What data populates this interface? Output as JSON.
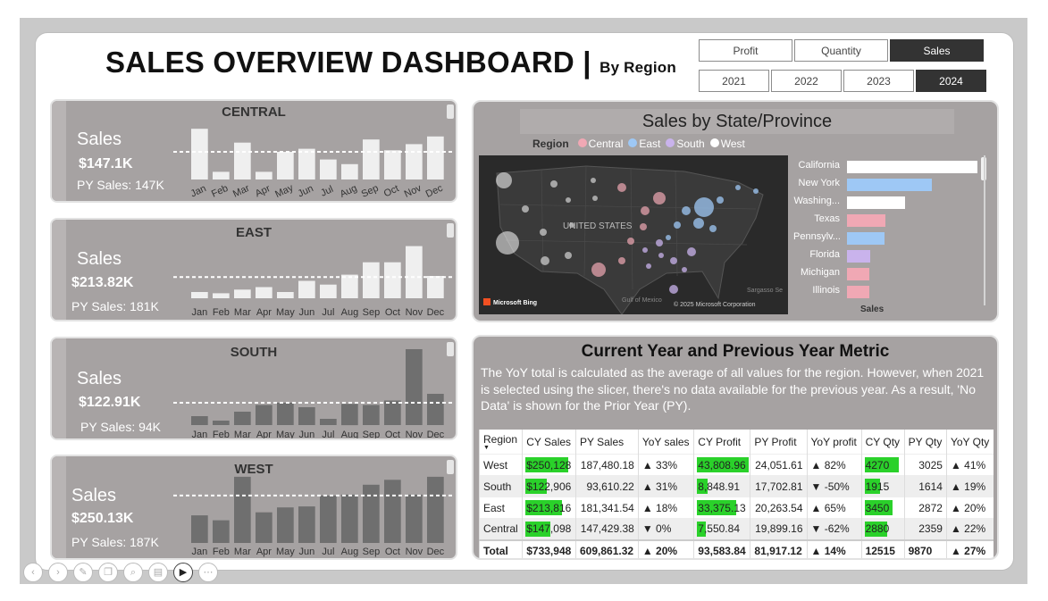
{
  "header": {
    "title": "SALES OVERVIEW DASHBOARD",
    "separator": "|",
    "subtitle": "By Region"
  },
  "measure_slicer": {
    "options": [
      "Profit",
      "Quantity",
      "Sales"
    ],
    "selected": "Sales"
  },
  "year_slicer": {
    "options": [
      "2021",
      "2022",
      "2023",
      "2024"
    ],
    "selected": "2024"
  },
  "region_cards": [
    {
      "region": "CENTRAL",
      "label": "Sales",
      "value": "$147.1K",
      "py": "PY Sales: 147K"
    },
    {
      "region": "EAST",
      "label": "Sales",
      "value": "$213.82K",
      "py": "PY Sales: 181K"
    },
    {
      "region": "SOUTH",
      "label": "Sales",
      "value": "$122.91K",
      "py": "PY Sales: 94K"
    },
    {
      "region": "WEST",
      "label": "Sales",
      "value": "$250.13K",
      "py": "PY Sales: 187K"
    }
  ],
  "chart_data": [
    {
      "type": "bar",
      "title": "CENTRAL",
      "categories": [
        "Jan",
        "Feb",
        "Mar",
        "Apr",
        "May",
        "Jun",
        "Jul",
        "Aug",
        "Sep",
        "Oct",
        "Nov",
        "Dec"
      ],
      "values": [
        16.5,
        2.5,
        12,
        2.5,
        9,
        10,
        6.5,
        5,
        13,
        9.5,
        11.5,
        14
      ],
      "ylim": [
        0,
        18
      ],
      "reference_line": 9
    },
    {
      "type": "bar",
      "title": "EAST",
      "categories": [
        "Jan",
        "Feb",
        "Mar",
        "Apr",
        "May",
        "Jun",
        "Jul",
        "Aug",
        "Sep",
        "Oct",
        "Nov",
        "Dec"
      ],
      "values": [
        2.5,
        2,
        3.5,
        4.5,
        2.5,
        7,
        5.5,
        9.5,
        14.5,
        14.5,
        21,
        9
      ],
      "ylim": [
        0,
        23
      ],
      "reference_line": 8.5
    },
    {
      "type": "bar",
      "title": "SOUTH",
      "categories": [
        "Jan",
        "Feb",
        "Mar",
        "Apr",
        "May",
        "Jun",
        "Jul",
        "Aug",
        "Sep",
        "Oct",
        "Nov",
        "Dec"
      ],
      "values": [
        4,
        2,
        6,
        9,
        10,
        8,
        2.8,
        9.5,
        9,
        11,
        34,
        14
      ],
      "ylim": [
        0,
        36
      ],
      "reference_line": 10
    },
    {
      "type": "bar",
      "title": "WEST",
      "categories": [
        "Jan",
        "Feb",
        "Mar",
        "Apr",
        "May",
        "Jun",
        "Jul",
        "Aug",
        "Sep",
        "Oct",
        "Nov",
        "Dec"
      ],
      "values": [
        14,
        11.5,
        33.5,
        15.5,
        18,
        18.5,
        24,
        24.5,
        29.5,
        32,
        24.5,
        33.5,
        34.5
      ],
      "ylim": [
        0,
        38
      ],
      "reference_line": 24
    }
  ],
  "map_panel": {
    "title": "Sales by State/Province",
    "legend_title": "Region",
    "legend": [
      {
        "name": "Central",
        "color": "#f0a8b4"
      },
      {
        "name": "East",
        "color": "#9ec8f5"
      },
      {
        "name": "South",
        "color": "#c9b3ec"
      },
      {
        "name": "West",
        "color": "#ffffff"
      }
    ],
    "map_label": "UNITED STATES",
    "map_labels_small": [
      "Gulf of Mexico",
      "Sargasso Se"
    ],
    "bing": "Microsoft Bing",
    "copyright": "© 2025 Microsoft Corporation",
    "bar_chart": {
      "type": "bar",
      "axis_title": "Sales",
      "states": [
        "California",
        "New York",
        "Washing...",
        "Texas",
        "Pennsylv...",
        "Florida",
        "Michigan",
        "Illinois"
      ],
      "values": [
        146,
        95,
        65,
        43,
        42,
        26,
        25,
        25
      ],
      "colors": [
        "#ffffff",
        "#9ec8f5",
        "#ffffff",
        "#f0a8b4",
        "#9ec8f5",
        "#c9b3ec",
        "#f0a8b4",
        "#f0a8b4"
      ]
    }
  },
  "metrics": {
    "title": "Current Year and Previous Year Metric",
    "description": "The YoY total is calculated as the average of all values for the region. However, when 2021 is selected using the slicer, there's no data available for the previous year. As a result, 'No Data' is shown for the Prior Year (PY).",
    "columns": [
      "Region",
      "CY Sales",
      "PY Sales",
      "YoY sales",
      "CY Profit",
      "PY Profit",
      "YoY profit",
      "CY Qty",
      "PY Qty",
      "YoY Qty"
    ],
    "rows": [
      {
        "region": "West",
        "cy_sales": "$250,128",
        "cy_sales_fill": 1.0,
        "py_sales": "187,480.18",
        "yoy_sales": "▲ 33%",
        "cy_profit": "43,808.96",
        "cy_profit_fill": 1.0,
        "py_profit": "24,051.61",
        "yoy_profit": "▲ 82%",
        "cy_qty": "4270",
        "cy_qty_fill": 1.0,
        "py_qty": "3025",
        "yoy_qty": "▲ 41%"
      },
      {
        "region": "South",
        "cy_sales": "$122,906",
        "cy_sales_fill": 0.49,
        "py_sales": "93,610.22",
        "yoy_sales": "▲ 31%",
        "cy_profit": "8,848.91",
        "cy_profit_fill": 0.2,
        "py_profit": "17,702.81",
        "yoy_profit": "▼ -50%",
        "cy_qty": "1915",
        "cy_qty_fill": 0.45,
        "py_qty": "1614",
        "yoy_qty": "▲ 19%"
      },
      {
        "region": "East",
        "cy_sales": "$213,816",
        "cy_sales_fill": 0.85,
        "py_sales": "181,341.54",
        "yoy_sales": "▲ 18%",
        "cy_profit": "33,375.13",
        "cy_profit_fill": 0.76,
        "py_profit": "20,263.54",
        "yoy_profit": "▲ 65%",
        "cy_qty": "3450",
        "cy_qty_fill": 0.81,
        "py_qty": "2872",
        "yoy_qty": "▲ 20%"
      },
      {
        "region": "Central",
        "cy_sales": "$147,098",
        "cy_sales_fill": 0.59,
        "py_sales": "147,429.38",
        "yoy_sales": "▼ 0%",
        "cy_profit": "7,550.84",
        "cy_profit_fill": 0.17,
        "py_profit": "19,899.16",
        "yoy_profit": "▼ -62%",
        "cy_qty": "2880",
        "cy_qty_fill": 0.67,
        "py_qty": "2359",
        "yoy_qty": "▲ 22%"
      }
    ],
    "total": {
      "region": "Total",
      "cy_sales": "$733,948",
      "py_sales": "609,861.32",
      "yoy_sales": "▲ 20%",
      "cy_profit": "93,583.84",
      "py_profit": "81,917.12",
      "yoy_profit": "▲ 14%",
      "cy_qty": "12515",
      "py_qty": "9870",
      "yoy_qty": "▲ 27%"
    }
  },
  "colors": {
    "card_bg": "#a6a2a2",
    "bar_light": "#efefef",
    "bar_dark": "#6f6f6f",
    "positive_fill": "#2ad12a"
  }
}
